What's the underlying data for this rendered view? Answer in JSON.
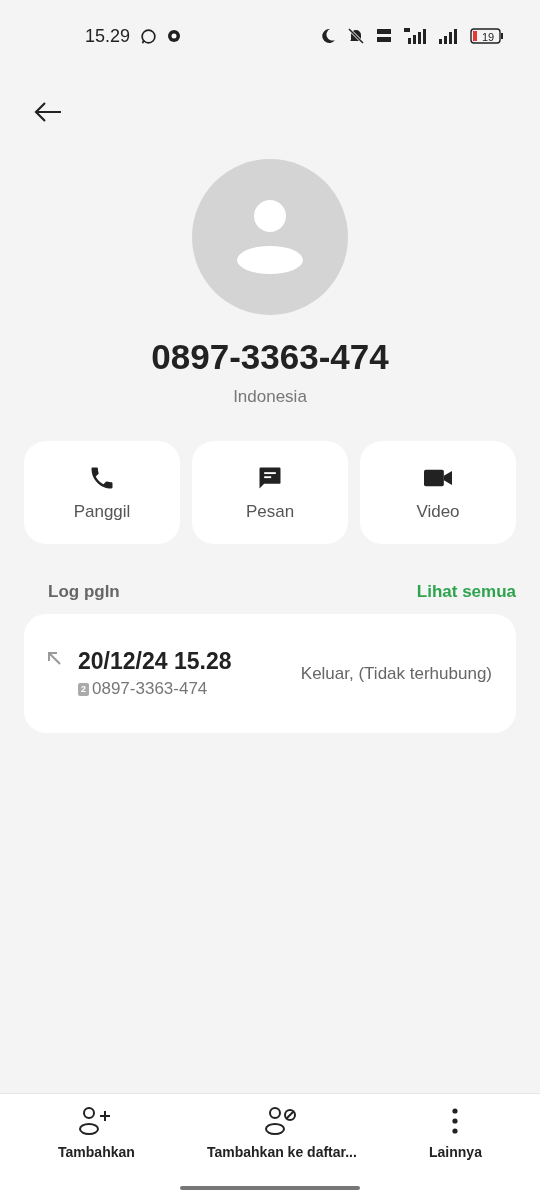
{
  "status_bar": {
    "time": "15.29",
    "battery": "19"
  },
  "contact": {
    "number": "0897-3363-474",
    "location": "Indonesia"
  },
  "actions": [
    {
      "kind": "call",
      "label": "Panggil"
    },
    {
      "kind": "message",
      "label": "Pesan"
    },
    {
      "kind": "video",
      "label": "Video"
    }
  ],
  "call_log": {
    "title": "Log pgln",
    "see_all": "Lihat semua",
    "entries": [
      {
        "datetime": "20/12/24 15.28",
        "sim": "2",
        "number": "0897-3363-474",
        "status": "Keluar, (Tidak terhubung)"
      }
    ]
  },
  "bottom_bar": [
    {
      "kind": "add",
      "label": "Tambahkan"
    },
    {
      "kind": "block",
      "label": "Tambahkan ke daftar..."
    },
    {
      "kind": "more",
      "label": "Lainnya"
    }
  ]
}
